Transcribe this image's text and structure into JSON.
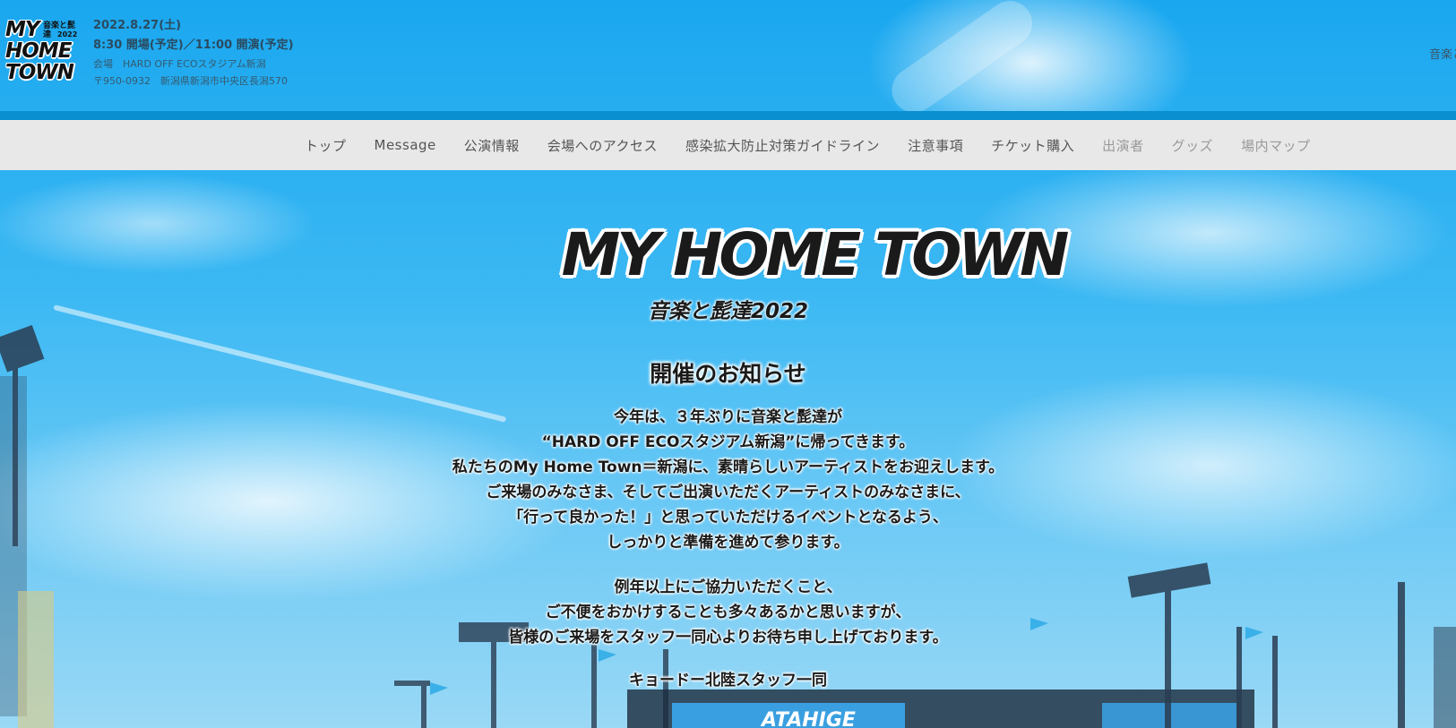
{
  "header": {
    "logo": {
      "line1": "MY",
      "line2": "HOME",
      "line3": "TOWN",
      "tagline": "音楽と髭達",
      "year": "2022"
    },
    "date": "2022.8.27(土)",
    "time": "8:30 開場(予定)／11:00 開演(予定)",
    "venue": "会場　HARD OFF ECOスタジアム新潟",
    "address": "〒950-0932　新潟県新潟市中央区長潟570",
    "right_text": "音楽と"
  },
  "nav": {
    "items": [
      {
        "label": "トップ",
        "enabled": true
      },
      {
        "label": "Message",
        "enabled": true
      },
      {
        "label": "公演情報",
        "enabled": true
      },
      {
        "label": "会場へのアクセス",
        "enabled": true
      },
      {
        "label": "感染拡大防止対策ガイドライン",
        "enabled": true
      },
      {
        "label": "注意事項",
        "enabled": true
      },
      {
        "label": "チケット購入",
        "enabled": true
      },
      {
        "label": "出演者",
        "enabled": false
      },
      {
        "label": "グッズ",
        "enabled": false
      },
      {
        "label": "場内マップ",
        "enabled": false
      }
    ]
  },
  "main": {
    "logo_text": "MY HOME TOWN",
    "subtitle": "音楽と髭達2022",
    "heading": "開催のお知らせ",
    "paragraph1": [
      "今年は、３年ぶりに音楽と髭達が",
      "“HARD OFF ECOスタジアム新潟”に帰ってきます。",
      "私たちのMy Home Town＝新潟に、素晴らしいアーティストをお迎えします。",
      "ご来場のみなさま、そしてご出演いただくアーティストのみなさまに、",
      "「行って良かった！」と思っていただけるイベントとなるよう、",
      "しっかりと準備を進めて参ります。"
    ],
    "paragraph2": [
      "例年以上にご協力いただくこと、",
      "ご不便をおかけすることも多々あるかと思いますが、",
      "皆様のご来場をスタッフ一同心よりお待ち申し上げております。"
    ],
    "signature": "キョードー北陸スタッフ一同"
  }
}
